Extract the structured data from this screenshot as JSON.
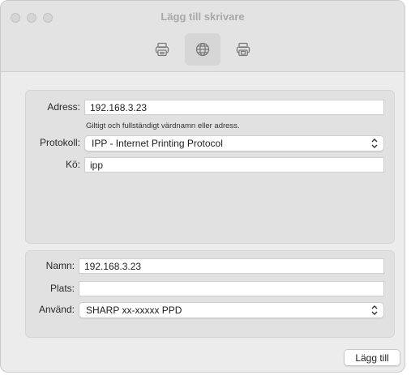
{
  "window": {
    "title": "Lägg till skrivare"
  },
  "toolbar": {
    "tabs": [
      {
        "icon": "printer-icon"
      },
      {
        "icon": "globe-icon",
        "selected": true
      },
      {
        "icon": "windows-printer-icon"
      }
    ]
  },
  "connection": {
    "address_label": "Adress:",
    "address_value": "192.168.3.23",
    "address_hint": "Giltigt och fullständigt värdnamn eller adress.",
    "protocol_label": "Protokoll:",
    "protocol_value": "IPP - Internet Printing Protocol",
    "queue_label": "Kö:",
    "queue_value": "ipp"
  },
  "details": {
    "name_label": "Namn:",
    "name_value": "192.168.3.23",
    "location_label": "Plats:",
    "location_value": "",
    "use_label": "Använd:",
    "use_value": "SHARP xx-xxxxx PPD"
  },
  "footer": {
    "add_button": "Lägg till"
  },
  "colors": {
    "window_bg": "#ececec",
    "group_bg": "#e1e1e1",
    "title_text": "#a9a9a9"
  }
}
